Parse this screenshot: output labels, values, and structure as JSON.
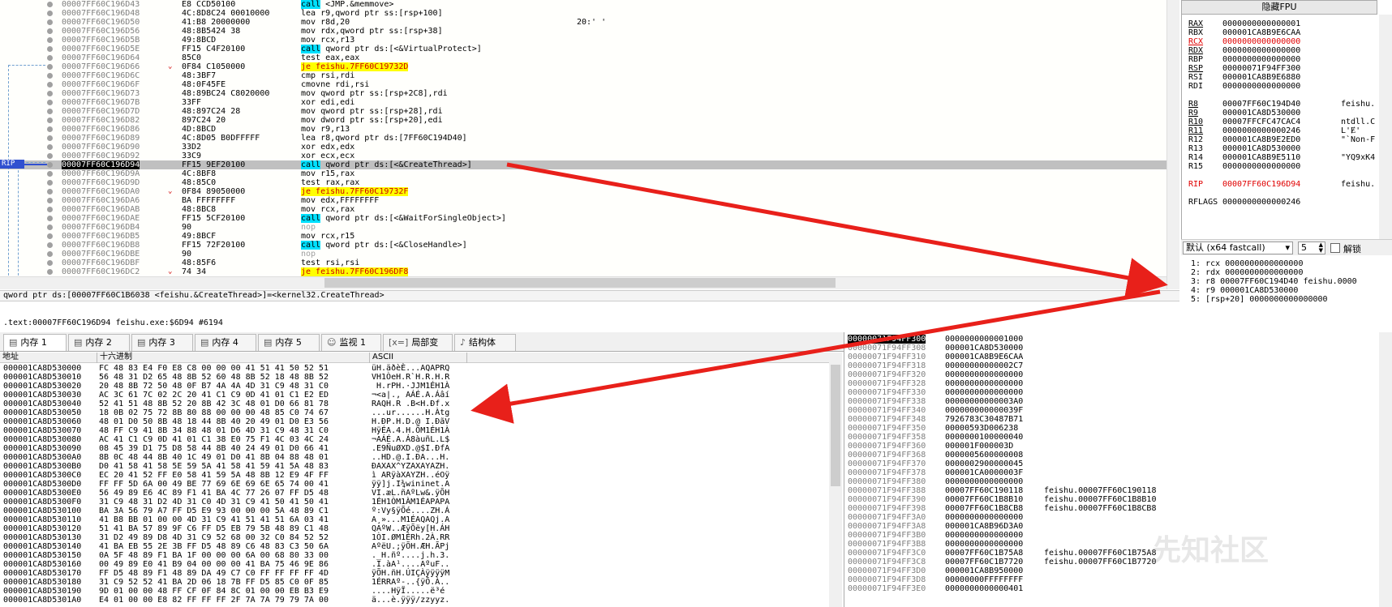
{
  "disasm": {
    "rows": [
      {
        "addr": "00007FF60C196D43",
        "bytes": "E8 CCD50100",
        "mn": "call <JMP.&memmove>",
        "type": "call"
      },
      {
        "addr": "00007FF60C196D48",
        "bytes": "4C:8D8C24 00010000",
        "mn": "lea r9,qword ptr ss:[rsp+100]"
      },
      {
        "addr": "00007FF60C196D50",
        "bytes": "41:B8 20000000",
        "mn": "mov r8d,20",
        "cm": "20:' '"
      },
      {
        "addr": "00007FF60C196D56",
        "bytes": "48:8B5424 38",
        "mn": "mov rdx,qword ptr ss:[rsp+38]"
      },
      {
        "addr": "00007FF60C196D5B",
        "bytes": "49:8BCD",
        "mn": "mov rcx,r13"
      },
      {
        "addr": "00007FF60C196D5E",
        "bytes": "FF15 C4F20100",
        "mn": "call qword ptr ds:[<&VirtualProtect>]",
        "type": "call"
      },
      {
        "addr": "00007FF60C196D64",
        "bytes": "85C0",
        "mn": "test eax,eax"
      },
      {
        "addr": "00007FF60C196D66",
        "bytes": "0F84 C1050000",
        "mn": "je feishu.7FF60C19732D",
        "type": "jmp",
        "arrow": "⌄"
      },
      {
        "addr": "00007FF60C196D6C",
        "bytes": "48:3BF7",
        "mn": "cmp rsi,rdi"
      },
      {
        "addr": "00007FF60C196D6F",
        "bytes": "48:0F45FE",
        "mn": "cmovne rdi,rsi"
      },
      {
        "addr": "00007FF60C196D73",
        "bytes": "48:89BC24 C8020000",
        "mn": "mov qword ptr ss:[rsp+2C8],rdi"
      },
      {
        "addr": "00007FF60C196D7B",
        "bytes": "33FF",
        "mn": "xor edi,edi"
      },
      {
        "addr": "00007FF60C196D7D",
        "bytes": "48:897C24 28",
        "mn": "mov qword ptr ss:[rsp+28],rdi"
      },
      {
        "addr": "00007FF60C196D82",
        "bytes": "897C24 20",
        "mn": "mov dword ptr ss:[rsp+20],edi"
      },
      {
        "addr": "00007FF60C196D86",
        "bytes": "4D:8BCD",
        "mn": "mov r9,r13"
      },
      {
        "addr": "00007FF60C196D89",
        "bytes": "4C:8D05 B0DFFFFF",
        "mn": "lea r8,qword ptr ds:[7FF60C194D40]"
      },
      {
        "addr": "00007FF60C196D90",
        "bytes": "33D2",
        "mn": "xor edx,edx"
      },
      {
        "addr": "00007FF60C196D92",
        "bytes": "33C9",
        "mn": "xor ecx,ecx"
      },
      {
        "addr": "00007FF60C196D94",
        "bytes": "FF15 9EF20100",
        "mn": "call qword ptr ds:[<&CreateThread>]",
        "type": "call",
        "cur": true
      },
      {
        "addr": "00007FF60C196D9A",
        "bytes": "4C:8BF8",
        "mn": "mov r15,rax"
      },
      {
        "addr": "00007FF60C196D9D",
        "bytes": "48:85C0",
        "mn": "test rax,rax"
      },
      {
        "addr": "00007FF60C196DA0",
        "bytes": "0F84 89050000",
        "mn": "je feishu.7FF60C19732F",
        "type": "jmp",
        "arrow": "⌄"
      },
      {
        "addr": "00007FF60C196DA6",
        "bytes": "BA FFFFFFFF",
        "mn": "mov edx,FFFFFFFF"
      },
      {
        "addr": "00007FF60C196DAB",
        "bytes": "48:8BC8",
        "mn": "mov rcx,rax"
      },
      {
        "addr": "00007FF60C196DAE",
        "bytes": "FF15 5CF20100",
        "mn": "call qword ptr ds:[<&WaitForSingleObject>]",
        "type": "call"
      },
      {
        "addr": "00007FF60C196DB4",
        "bytes": "90",
        "mn": "nop",
        "type": "nop"
      },
      {
        "addr": "00007FF60C196DB5",
        "bytes": "49:8BCF",
        "mn": "mov rcx,r15"
      },
      {
        "addr": "00007FF60C196DB8",
        "bytes": "FF15 72F20100",
        "mn": "call qword ptr ds:[<&CloseHandle>]",
        "type": "call"
      },
      {
        "addr": "00007FF60C196DBE",
        "bytes": "90",
        "mn": "nop",
        "type": "nop"
      },
      {
        "addr": "00007FF60C196DBF",
        "bytes": "48:85F6",
        "mn": "test rsi,rsi"
      },
      {
        "addr": "00007FF60C196DC2",
        "bytes": "74 34",
        "mn": "je feishu.7FF60C196DF8",
        "type": "jmp",
        "arrow": "⌄"
      }
    ],
    "rip_label": "RIP",
    "info_line": "qword ptr ds:[00007FF60C1B6038 <feishu.&CreateThread>]=<kernel32.CreateThread>",
    "location_line": ".text:00007FF60C196D94 feishu.exe:$6D94 #6194"
  },
  "registers": {
    "fpu_button": "隐藏FPU",
    "rows": [
      {
        "n": "RAX",
        "v": "0000000000000001",
        "ul": true
      },
      {
        "n": "RBX",
        "v": "000001CA8B9E6CAA"
      },
      {
        "n": "RCX",
        "v": "0000000000000000",
        "ul": true,
        "red": true
      },
      {
        "n": "RDX",
        "v": "0000000000000000",
        "ul": true
      },
      {
        "n": "RBP",
        "v": "0000000000000000"
      },
      {
        "n": "RSP",
        "v": "00000071F94FF300",
        "ul": true
      },
      {
        "n": "RSI",
        "v": "000001CA8B9E6880"
      },
      {
        "n": "RDI",
        "v": "0000000000000000"
      },
      {
        "n": "",
        "v": ""
      },
      {
        "n": "R8",
        "v": "00007FF60C194D40",
        "x": "feishu.",
        "ul": true
      },
      {
        "n": "R9",
        "v": "000001CA8D530000",
        "ul": true
      },
      {
        "n": "R10",
        "v": "00007FFCFC47CAC4",
        "x": "ntdll.C",
        "ul": true
      },
      {
        "n": "R11",
        "v": "0000000000000246",
        "x": "L'Ɇ'",
        "ul": true
      },
      {
        "n": "R12",
        "v": "000001CA8B9E2ED0",
        "x": "\"`Non-F"
      },
      {
        "n": "R13",
        "v": "000001CA8D530000"
      },
      {
        "n": "R14",
        "v": "000001CA8B9E5110",
        "x": "\"YQ9xK4"
      },
      {
        "n": "R15",
        "v": "0000000000000000"
      },
      {
        "n": "",
        "v": ""
      },
      {
        "n": "RIP",
        "v": "00007FF60C196D94",
        "x": "feishu.",
        "red": true
      },
      {
        "n": "",
        "v": ""
      },
      {
        "n": "RFLAGS",
        "v": "0000000000000246"
      }
    ],
    "callconv": "默认 (x64 fastcall)",
    "argcount": "5",
    "unlock_label": "解锁",
    "args": [
      "1: rcx 0000000000000000",
      "2: rdx 0000000000000000",
      "3: r8 00007FF60C194D40 feishu.0000",
      "4: r9 000001CA8D530000",
      "5: [rsp+20] 0000000000000000"
    ]
  },
  "tabs": [
    {
      "label": "内存 1",
      "icon": "memory-icon",
      "active": true
    },
    {
      "label": "内存 2",
      "icon": "memory-icon"
    },
    {
      "label": "内存 3",
      "icon": "memory-icon"
    },
    {
      "label": "内存 4",
      "icon": "memory-icon"
    },
    {
      "label": "内存 5",
      "icon": "memory-icon"
    },
    {
      "label": "监视 1",
      "icon": "watch-icon"
    },
    {
      "label": "局部变量",
      "icon": "locals-icon",
      "prefix": "[x=]"
    },
    {
      "label": "结构体",
      "icon": "struct-icon"
    }
  ],
  "dump": {
    "headers": [
      "地址",
      "十六进制",
      "ASCII"
    ],
    "rows": [
      [
        "000001CA8D530000",
        "FC 48 83 E4 F0 E8 C8 00 00 00 41 51 41 50 52 51",
        "üH.äðèÈ...AQAPRQ"
      ],
      [
        "000001CA8D530010",
        "56 48 31 D2 65 48 8B 52 60 48 8B 52 18 48 8B 52",
        "VH1ÒeH.R`H.R.H.R"
      ],
      [
        "000001CA8D530020",
        "20 48 8B 72 50 48 0F B7 4A 4A 4D 31 C9 48 31 C0",
        " H.rPH.·JJM1ÉH1À"
      ],
      [
        "000001CA8D530030",
        "AC 3C 61 7C 02 2C 20 41 C1 C9 0D 41 01 C1 E2 ED",
        "¬<a|., AÁÉ.A.Áâí"
      ],
      [
        "000001CA8D530040",
        "52 41 51 48 8B 52 20 8B 42 3C 48 01 D0 66 81 78",
        "RAQH.R .B<H.Ðf.x"
      ],
      [
        "000001CA8D530050",
        "18 0B 02 75 72 8B 80 88 00 00 00 48 85 C0 74 67",
        "...ur......H.Àtg"
      ],
      [
        "000001CA8D530060",
        "48 01 D0 50 8B 48 18 44 8B 40 20 49 01 D0 E3 56",
        "H.ÐP.H.D.@ I.ÐãV"
      ],
      [
        "000001CA8D530070",
        "48 FF C9 41 8B 34 88 48 01 D6 4D 31 C9 48 31 C0",
        "HÿÉA.4.H.ÖM1ÉH1À"
      ],
      [
        "000001CA8D530080",
        "AC 41 C1 C9 0D 41 01 C1 38 E0 75 F1 4C 03 4C 24",
        "¬AÁÉ.A.Á8àuñL.L$"
      ],
      [
        "000001CA8D530090",
        "08 45 39 D1 75 D8 58 44 8B 40 24 49 01 D0 66 41",
        ".E9ÑuØXD.@$I.ÐfA"
      ],
      [
        "000001CA8D5300A0",
        "8B 0C 48 44 8B 40 1C 49 01 D0 41 8B 04 88 48 01",
        "..HD.@.I.ÐA...H."
      ],
      [
        "000001CA8D5300B0",
        "D0 41 58 41 58 5E 59 5A 41 58 41 59 41 5A 48 83",
        "ÐAXAX^YZAXAYAZH."
      ],
      [
        "000001CA8D5300C0",
        "EC 20 41 52 FF E0 58 41 59 5A 48 8B 12 E9 4F FF",
        "ì ARÿàXAYZH..éOÿ"
      ],
      [
        "000001CA8D5300D0",
        "FF FF 5D 6A 00 49 BE 77 69 6E 69 6E 65 74 00 41",
        "ÿÿ]j.I¾wininet.A"
      ],
      [
        "000001CA8D5300E0",
        "56 49 89 E6 4C 89 F1 41 BA 4C 77 26 07 FF D5 48",
        "VI.æL.ñAºLw&.ÿÕH"
      ],
      [
        "000001CA8D5300F0",
        "31 C9 48 31 D2 4D 31 C0 4D 31 C9 41 50 41 50 41",
        "1ÉH1ÒM1ÀM1ÉAPAPA"
      ],
      [
        "000001CA8D530100",
        "BA 3A 56 79 A7 FF D5 E9 93 00 00 00 5A 48 89 C1",
        "º:Vy§ÿÕé....ZH.Á"
      ],
      [
        "000001CA8D530110",
        "41 B8 BB 01 00 00 4D 31 C9 41 51 41 51 6A 03 41",
        "A¸»...M1ÉAQAQj.A"
      ],
      [
        "000001CA8D530120",
        "51 41 BA 57 89 9F C6 FF D5 EB 79 5B 48 89 C1 48",
        "QAºW..ÆÿÕëy[H.ÁH"
      ],
      [
        "000001CA8D530130",
        "31 D2 49 89 D8 4D 31 C9 52 68 00 32 C0 84 52 52",
        "1ÒI.ØM1ÉRh.2À.RR"
      ],
      [
        "000001CA8D530140",
        "41 BA EB 55 2E 3B FF D5 48 89 C6 48 83 C3 50 6A",
        "AºëU.;ÿÕH.ÆH.ÃPj"
      ],
      [
        "000001CA8D530150",
        "0A 5F 48 89 F1 BA 1F 00 00 00 6A 00 68 80 33 00",
        "._H.ñº....j.h.3."
      ],
      [
        "000001CA8D530160",
        "00 49 89 E0 41 B9 04 00 00 00 41 BA 75 46 9E 86",
        ".I.àA¹....AºuF.."
      ],
      [
        "000001CA8D530170",
        "FF D5 48 89 F1 48 89 DA 49 C7 C0 FF FF FF FF 4D",
        "ÿÕH.ñH.ÚIÇÀÿÿÿÿM"
      ],
      [
        "000001CA8D530180",
        "31 C9 52 52 41 BA 2D 06 18 7B FF D5 85 C0 0F 85",
        "1ÉRRAº-..{ÿÕ.À.."
      ],
      [
        "000001CA8D530190",
        "9D 01 00 00 48 FF CF 0F 84 8C 01 00 00 EB B3 E9",
        "....HÿÏ.....ë³é"
      ],
      [
        "000001CA8D5301A0",
        "E4 01 00 00 E8 82 FF FF FF 2F 7A 7A 79 79 7A 00",
        "ä...è.ÿÿÿ/zzyyz."
      ]
    ]
  },
  "stack": {
    "rows": [
      [
        "00000071F94FF300",
        "0000000000001000",
        ""
      ],
      [
        "00000071F94FF308",
        "000001CA8D530000",
        ""
      ],
      [
        "00000071F94FF310",
        "000001CA8B9E6CAA",
        ""
      ],
      [
        "00000071F94FF318",
        "00000000000002C7",
        ""
      ],
      [
        "00000071F94FF320",
        "0000000000000000",
        ""
      ],
      [
        "00000071F94FF328",
        "0000000000000000",
        ""
      ],
      [
        "00000071F94FF330",
        "0000000000000000",
        ""
      ],
      [
        "00000071F94FF338",
        "00000000000003A0",
        ""
      ],
      [
        "00000071F94FF340",
        "000000000000039F",
        ""
      ],
      [
        "00000071F94FF348",
        "7926783C30487B71",
        ""
      ],
      [
        "00000071F94FF350",
        "00000593D006238",
        ""
      ],
      [
        "00000071F94FF358",
        "0000000100000040",
        ""
      ],
      [
        "00000071F94FF360",
        "000001F000003D",
        ""
      ],
      [
        "00000071F94FF368",
        "0000005600000008",
        ""
      ],
      [
        "00000071F94FF370",
        "0000002900000045",
        ""
      ],
      [
        "00000071F94FF378",
        "000001CA0000003F",
        ""
      ],
      [
        "00000071F94FF380",
        "0000000000000000",
        ""
      ],
      [
        "00000071F94FF388",
        "00007FF60C190118",
        "feishu.00007FF60C190118"
      ],
      [
        "00000071F94FF390",
        "00007FF60C1B8B10",
        "feishu.00007FF60C1B8B10"
      ],
      [
        "00000071F94FF398",
        "00007FF60C1B8CB8",
        "feishu.00007FF60C1B8CB8"
      ],
      [
        "00000071F94FF3A0",
        "0000000000000000",
        ""
      ],
      [
        "00000071F94FF3A8",
        "000001CA8B96D3A0",
        ""
      ],
      [
        "00000071F94FF3B0",
        "0000000000000000",
        ""
      ],
      [
        "00000071F94FF3B8",
        "0000000000000000",
        ""
      ],
      [
        "00000071F94FF3C0",
        "00007FF60C1B75A8",
        "feishu.00007FF60C1B75A8"
      ],
      [
        "00000071F94FF3C8",
        "00007FF60C1B7720",
        "feishu.00007FF60C1B7720"
      ],
      [
        "00000071F94FF3D0",
        "000001CA8B950000",
        ""
      ],
      [
        "00000071F94FF3D8",
        "00000000FFFFFFFF",
        ""
      ],
      [
        "00000071F94FF3E0",
        "0000000000000401",
        ""
      ]
    ]
  },
  "watermark": "先知社区",
  "colors": {
    "arrow": "#e8201a",
    "rip": "#3050d0"
  }
}
